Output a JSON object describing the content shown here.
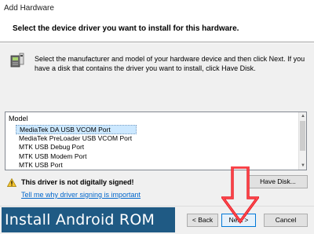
{
  "window": {
    "title": "Add Hardware"
  },
  "header": {
    "heading": "Select the device driver you want to install for this hardware."
  },
  "instructions": "Select the manufacturer and model of your hardware device and then click Next. If you have a disk that contains the driver you want to install, click Have Disk.",
  "model_list": {
    "header": "Model",
    "items": [
      "MediaTek DA USB VCOM Port",
      "MediaTek PreLoader USB VCOM Port",
      "MTK USB Debug Port",
      "MTK USB Modem Port",
      "MTK USB Port"
    ],
    "selected": "MediaTek DA USB VCOM Port"
  },
  "warning": {
    "text": "This driver is not digitally signed!",
    "link": "Tell me why driver signing is important"
  },
  "buttons": {
    "have_disk": "Have Disk...",
    "back": "< Back",
    "next": "Next >",
    "cancel": "Cancel"
  },
  "banner": {
    "text": "Install Android ROM"
  },
  "icons": {
    "hardware": "hardware-device-icon",
    "warning": "warning-shield-icon",
    "arrow": "red-down-arrow-icon"
  },
  "colors": {
    "banner_bg": "#1f5a84",
    "arrow": "#e8222a",
    "link": "#0066cc",
    "selection": "#cce8ff"
  }
}
